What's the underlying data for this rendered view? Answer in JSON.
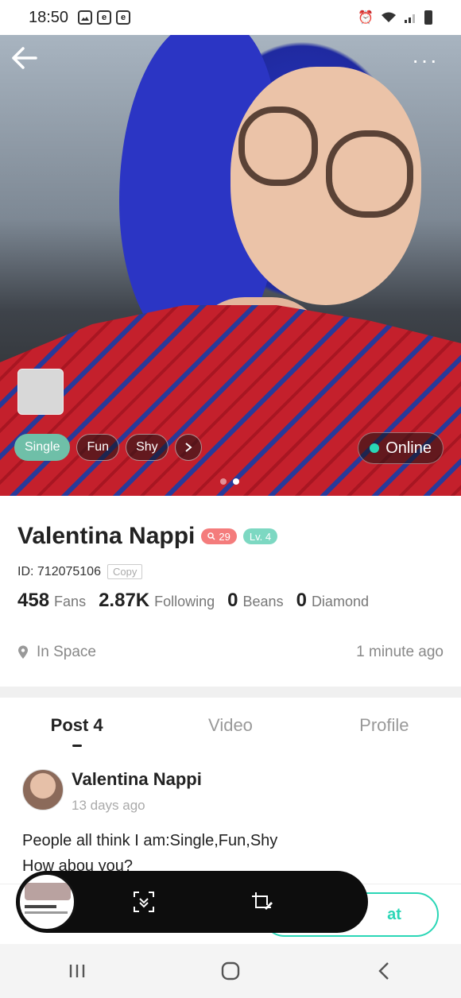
{
  "status_bar": {
    "time": "18:50",
    "left_icons": [
      "image-icon",
      "e-icon",
      "e-icon"
    ],
    "right_icons": [
      "alarm-icon",
      "wifi-icon",
      "signal-icon",
      "battery-icon"
    ]
  },
  "hero": {
    "tags": [
      "Single",
      "Fun",
      "Shy"
    ],
    "online_label": "Online",
    "online_color": "#2ad6b6",
    "carousel_index": 2,
    "carousel_count": 2
  },
  "profile": {
    "name": "Valentina Nappi",
    "age_badge": "29",
    "level_badge": "Lv. 4",
    "id_text": "ID: 712075106",
    "copy_label": "Copy",
    "stats": [
      {
        "value": "458",
        "label": "Fans"
      },
      {
        "value": "2.87K",
        "label": "Following"
      },
      {
        "value": "0",
        "label": "Beans"
      },
      {
        "value": "0",
        "label": "Diamond"
      }
    ],
    "location": "In Space",
    "last_seen": "1 minute ago"
  },
  "tabs": [
    {
      "label": "Post 4",
      "active": true
    },
    {
      "label": "Video",
      "active": false
    },
    {
      "label": "Profile",
      "active": false
    }
  ],
  "post": {
    "author": "Valentina Nappi",
    "time": "13 days ago",
    "text": "People all think I am:Single,Fun,Shy\nHow abou you?"
  },
  "bottom_bar": {
    "chat_label": "at"
  },
  "colors": {
    "accent": "#2ad6b6",
    "tag_primary": "#6fbfa8",
    "age_badge": "#f47c7c",
    "level_badge": "#7dd8c2"
  }
}
